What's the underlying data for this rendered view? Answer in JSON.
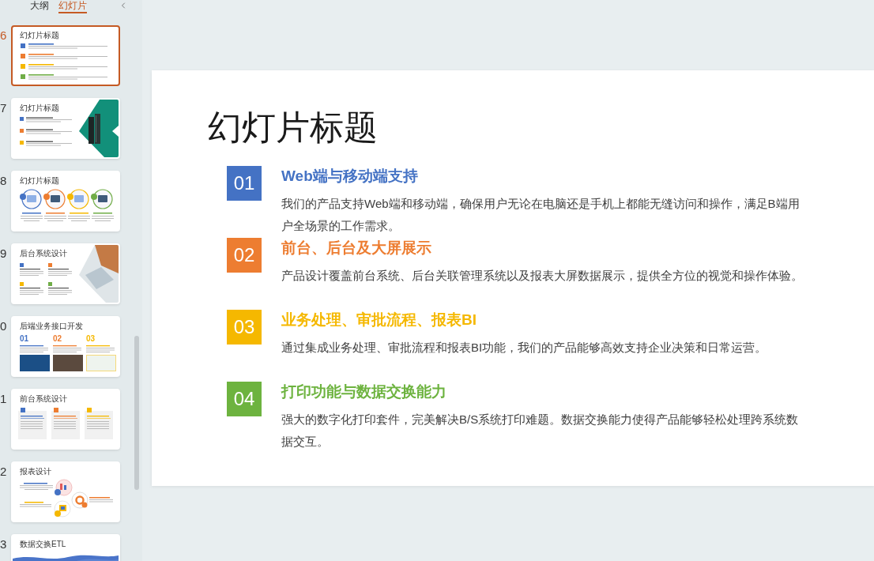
{
  "slide_panel": {
    "tabs": [
      {
        "label": "大纲",
        "selected": false
      },
      {
        "label": "幻灯片",
        "selected": true
      }
    ],
    "slides": [
      {
        "number": "6",
        "kind": "list",
        "title": "幻灯片标题",
        "selected": true
      },
      {
        "number": "7",
        "kind": "split-teal",
        "title": "幻灯片标题",
        "selected": false
      },
      {
        "number": "8",
        "kind": "circles",
        "title": "幻灯片标题",
        "selected": false
      },
      {
        "number": "9",
        "kind": "split-photo",
        "title": "后台系统设计",
        "selected": false
      },
      {
        "number": "0",
        "kind": "columns",
        "title": "后端业务接口开发",
        "selected": false,
        "columns": [
          {
            "label": "01",
            "color": "#4472c4"
          },
          {
            "label": "02",
            "color": "#ed7d31"
          },
          {
            "label": "03",
            "color": "#f5b800"
          }
        ]
      },
      {
        "number": "1",
        "kind": "cards",
        "title": "前台系统设计",
        "selected": false
      },
      {
        "number": "2",
        "kind": "diagram",
        "title": "报表设计",
        "selected": false
      },
      {
        "number": "3",
        "kind": "wave",
        "title": "数据交换ETL",
        "selected": false
      }
    ]
  },
  "slide": {
    "title": "幻灯片标题",
    "items": [
      {
        "number": "01",
        "heading": "Web端与移动端支持",
        "text": "我们的产品支持Web端和移动端，确保用户无论在电脑还是手机上都能无缝访问和操作，满足B端用户全场景的工作需求。",
        "color": "#4472c4"
      },
      {
        "number": "02",
        "heading": "前台、后台及大屏展示",
        "text": "产品设计覆盖前台系统、后台关联管理系统以及报表大屏数据展示，提供全方位的视觉和操作体验。",
        "color": "#ed7d31"
      },
      {
        "number": "03",
        "heading": "业务处理、审批流程、报表BI",
        "text": "通过集成业务处理、审批流程和报表BI功能，我们的产品能够高效支持企业决策和日常运营。",
        "color": "#f5b800"
      },
      {
        "number": "04",
        "heading": "打印功能与数据交换能力",
        "text": "强大的数字化打印套件，完美解决B/S系统打印难题。数据交换能力使得产品能够轻松处理跨系统数据交互。",
        "color": "#6db33f"
      }
    ]
  }
}
